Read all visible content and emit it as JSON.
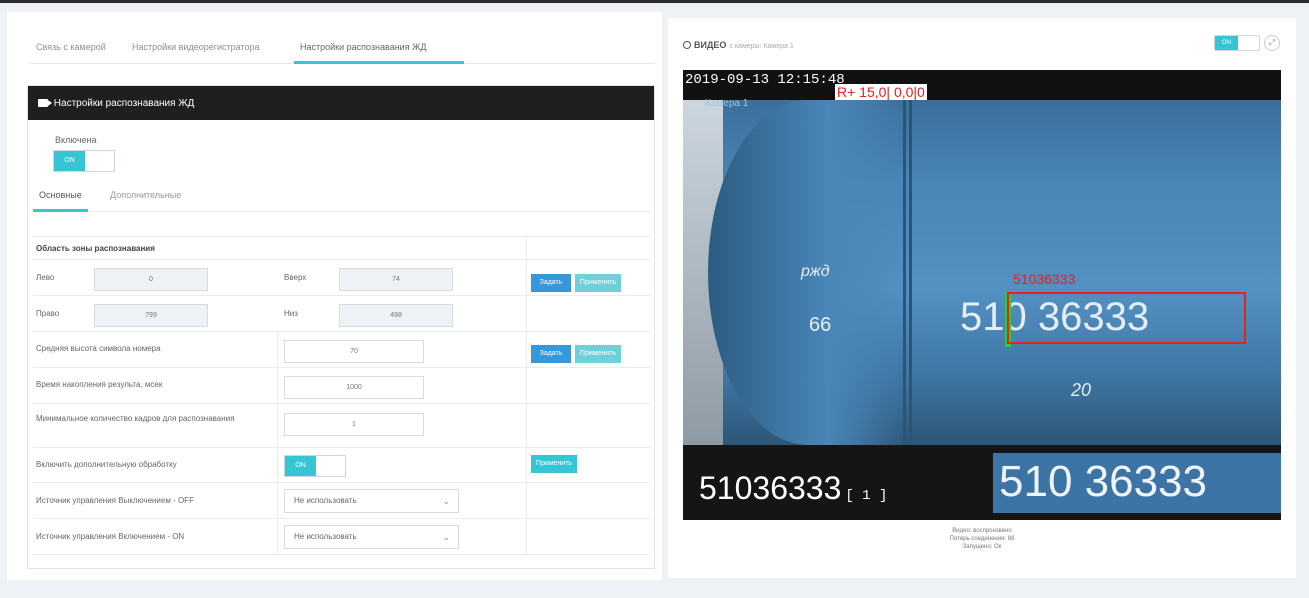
{
  "tabs": [
    {
      "label": "Связь с камерой"
    },
    {
      "label": "Настройки видеорегистратора"
    },
    {
      "label": "Настройки распознавания ЖД"
    }
  ],
  "card": {
    "title": "Настройки распознавания ЖД"
  },
  "enabled": {
    "label": "Включена",
    "state": "ON"
  },
  "subtabs": [
    {
      "label": "Основные"
    },
    {
      "label": "Дополнительные"
    }
  ],
  "zone": {
    "section_title": "Область зоны распознавания",
    "left_label": "Лево",
    "left_value": "0",
    "up_label": "Вверх",
    "up_value": "74",
    "right_label": "Право",
    "right_value": "799",
    "down_label": "Низ",
    "down_value": "498"
  },
  "fields": {
    "avg_height_label": "Средняя высота символа номера",
    "avg_height_value": "70",
    "accum_time_label": "Время накопления результа, мсек",
    "accum_time_value": "1000",
    "min_frames_label": "Минимальное количество кадров для распознавания",
    "min_frames_value": "1",
    "extra_proc_label": "Включить дополнительную обработку",
    "extra_proc_state": "ON",
    "off_source_label": "Источник управления Выключением - OFF",
    "off_source_value": "Не использовать",
    "on_source_label": "Источник управления Включением - ON",
    "on_source_value": "Не использовать"
  },
  "buttons": {
    "set": "Задать",
    "apply": "Применить"
  },
  "video": {
    "title": "ВИДЕО",
    "subtitle": "с камеры: Камера 1",
    "toggle_state": "ON",
    "timestamp": "2019-09-13 12:15:48",
    "overlay_text": "R+ 15,0| 0,0|0",
    "camera_label": "Камера 1",
    "detected_number": "51036333",
    "plate_text": "510 36333",
    "wagon_logo": "ржд",
    "wagon_num_66": "66",
    "wagon_num_20": "20",
    "result_number": "51036333",
    "result_index": "[ 1 ]",
    "plate_crop": "510 36333"
  },
  "status": {
    "video": "Видео: воспроизвено",
    "losses": "Потерь соединения: 88",
    "started": "Запущено: Ок"
  },
  "colors": {
    "accent": "#36c6d3",
    "blue_btn": "#3598dc",
    "detect": "#e82020",
    "marker": "#24d12a"
  }
}
